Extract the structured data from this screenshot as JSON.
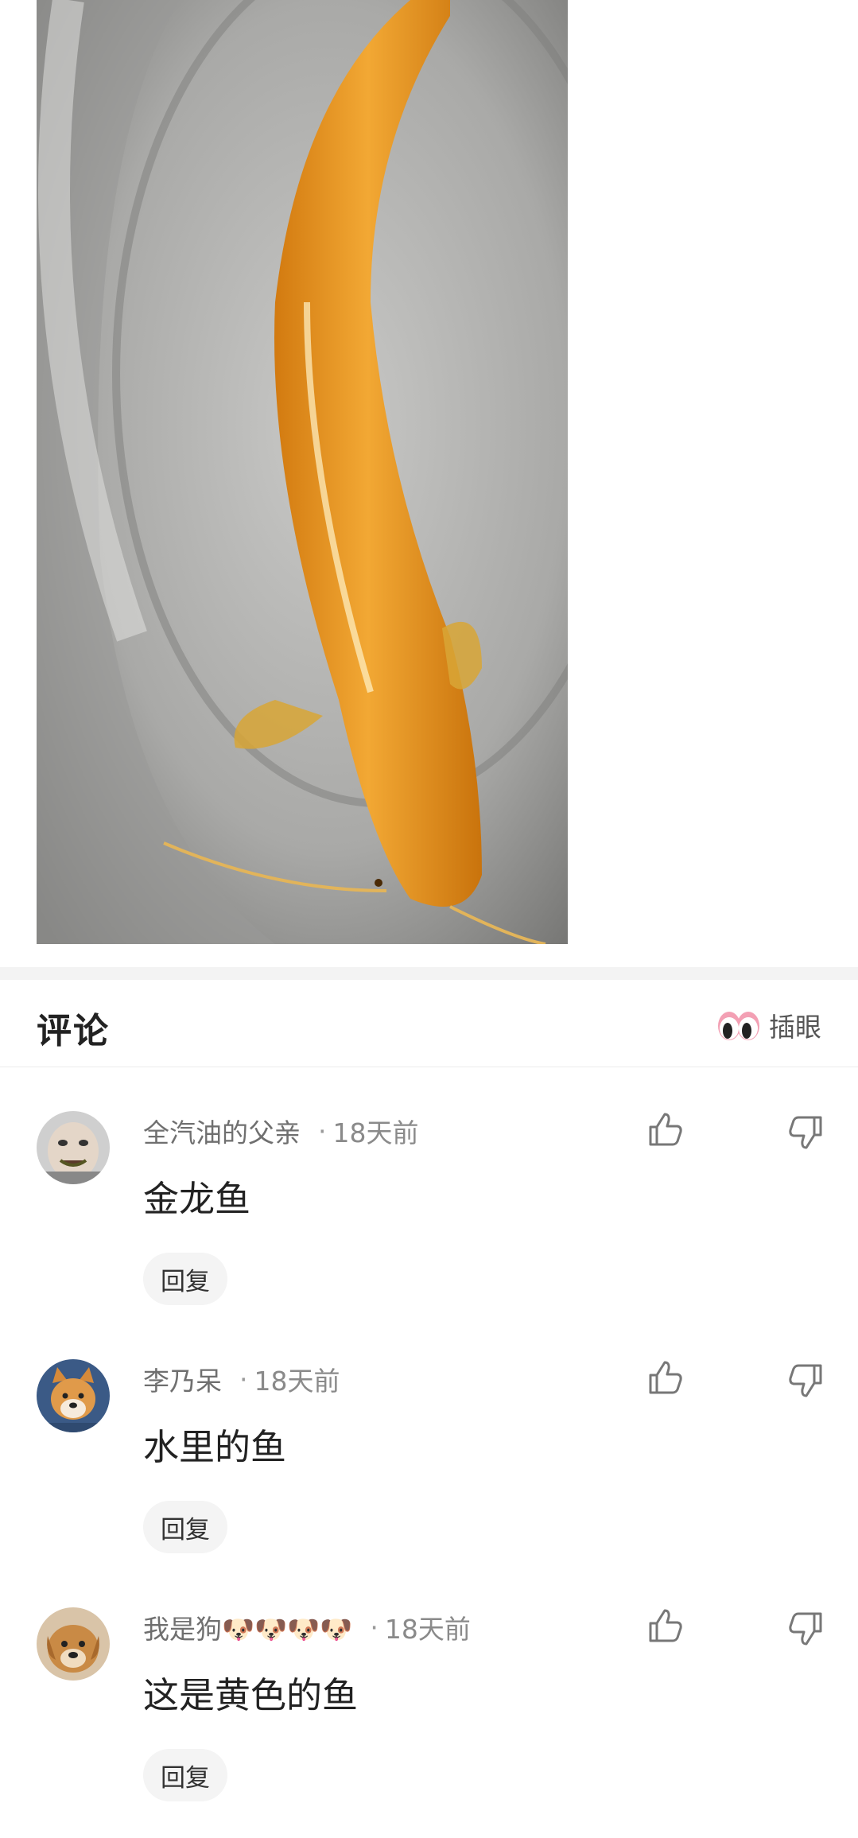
{
  "post": {
    "image_icon": "golden-catfish-photo"
  },
  "comments_section": {
    "title": "评论",
    "interject_label": "插眼",
    "interject_icon": "eyes-icon"
  },
  "comments": [
    {
      "username": "全汽油的父亲",
      "timestamp": "18天前",
      "text": "金龙鱼",
      "reply_label": "回复",
      "avatar_icon": "face-avatar"
    },
    {
      "username": "李乃呆",
      "timestamp": "18天前",
      "text": "水里的鱼",
      "reply_label": "回复",
      "avatar_icon": "shiba-dog-avatar"
    },
    {
      "username": "我是狗🐶🐶🐶🐶",
      "timestamp": "18天前",
      "text": "这是黄色的鱼",
      "reply_label": "回复",
      "avatar_icon": "puppy-avatar"
    }
  ],
  "sep_dot": "·",
  "colors": {
    "accent_gold": "#e89a1c",
    "text_primary": "#222222",
    "text_meta": "#888888",
    "reply_bg": "#f4f4f4"
  }
}
